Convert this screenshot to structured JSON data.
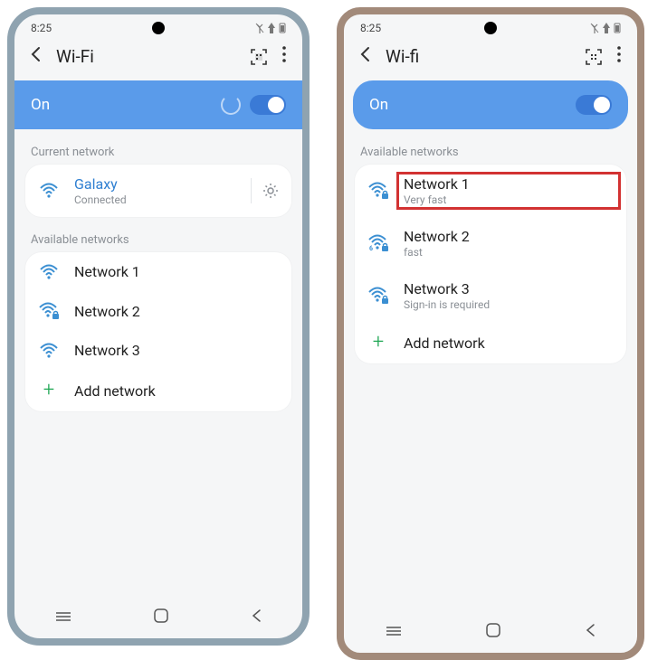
{
  "status_time": "8:25",
  "left": {
    "title": "Wi-Fi",
    "toggle_label": "On",
    "current_label": "Current network",
    "current_network": {
      "name": "Galaxy",
      "status": "Connected"
    },
    "available_label": "Available networks",
    "networks": [
      {
        "name": "Network 1"
      },
      {
        "name": "Network 2"
      },
      {
        "name": "Network 3"
      }
    ],
    "add_label": "Add network"
  },
  "right": {
    "title": "Wi-fi",
    "toggle_label": "On",
    "available_label": "Available networks",
    "networks": [
      {
        "name": "Network 1",
        "sub": "Very fast"
      },
      {
        "name": "Network 2",
        "sub": "fast"
      },
      {
        "name": "Network 3",
        "sub": "Sign-in is required"
      }
    ],
    "add_label": "Add network"
  }
}
